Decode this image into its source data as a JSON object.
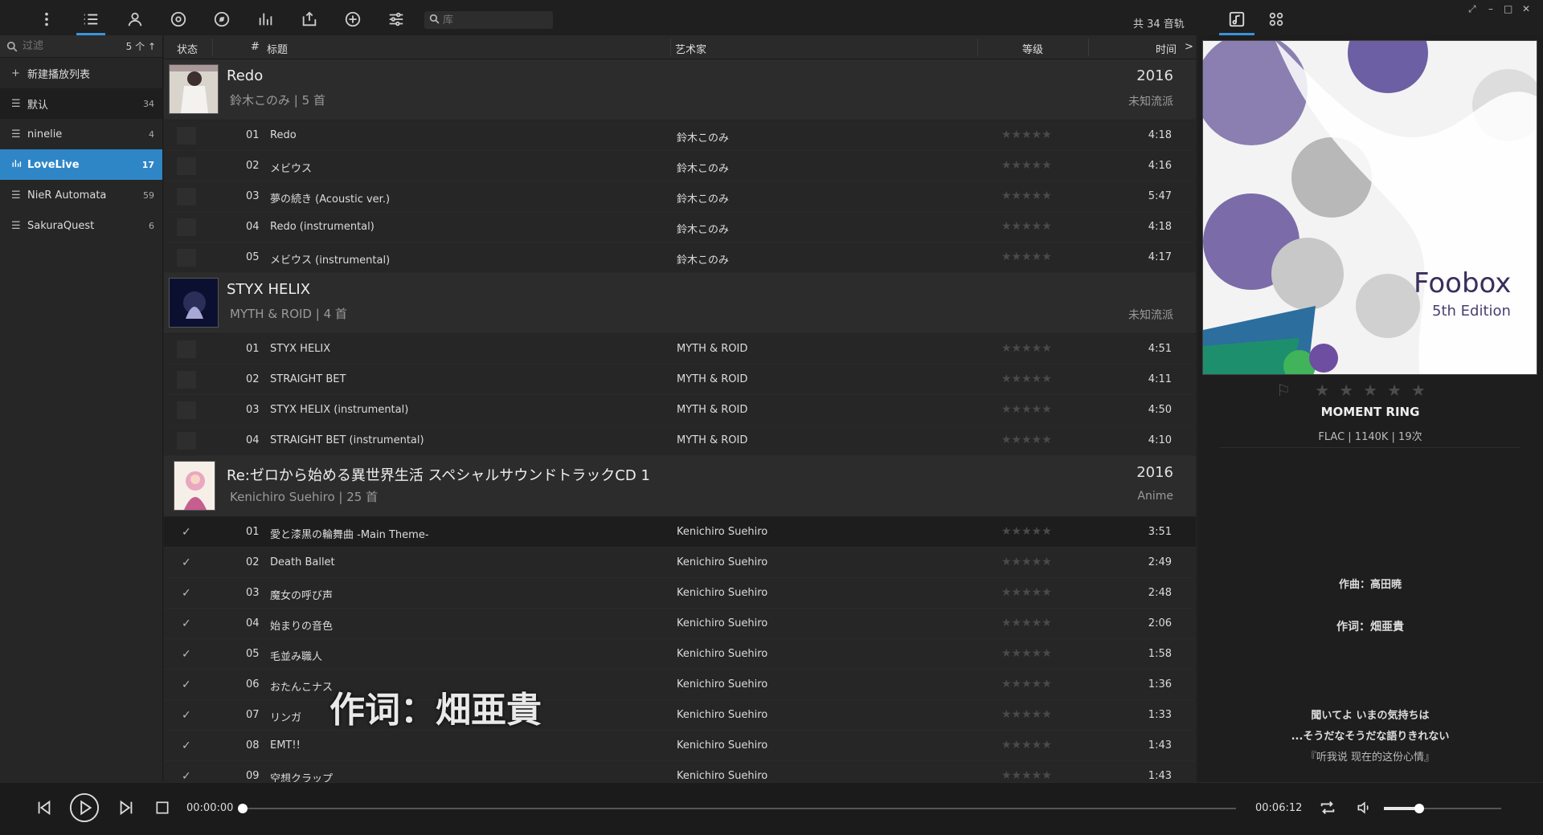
{
  "toolbar": {
    "search_placeholder": "库",
    "track_total": "共 34 音轨"
  },
  "sidebar": {
    "filter_placeholder": "过滤",
    "filter_count": "5 个",
    "new_playlist": "新建播放列表",
    "items": [
      {
        "name": "默认",
        "count": "34"
      },
      {
        "name": "ninelie",
        "count": "4"
      },
      {
        "name": "LoveLive",
        "count": "17"
      },
      {
        "name": "NieR Automata",
        "count": "59"
      },
      {
        "name": "SakuraQuest",
        "count": "6"
      }
    ]
  },
  "columns": {
    "status": "状态",
    "num": "#",
    "title": "标题",
    "artist": "艺术家",
    "rating": "等级",
    "time": "时间",
    "more": ">"
  },
  "groups": [
    {
      "title": "Redo",
      "subtitle": "鈴木このみ | 5 首",
      "year": "2016",
      "genre": "未知流派",
      "tracks": [
        {
          "num": "01",
          "title": "Redo",
          "artist": "鈴木このみ",
          "time": "4:18"
        },
        {
          "num": "02",
          "title": "メビウス",
          "artist": "鈴木このみ",
          "time": "4:16"
        },
        {
          "num": "03",
          "title": "夢の続き (Acoustic ver.)",
          "artist": "鈴木このみ",
          "time": "5:47"
        },
        {
          "num": "04",
          "title": "Redo (instrumental)",
          "artist": "鈴木このみ",
          "time": "4:18"
        },
        {
          "num": "05",
          "title": "メビウス (instrumental)",
          "artist": "鈴木このみ",
          "time": "4:17"
        }
      ]
    },
    {
      "title": "STYX HELIX",
      "subtitle": "MYTH & ROID | 4 首",
      "year": "",
      "genre": "未知流派",
      "tracks": [
        {
          "num": "01",
          "title": "STYX HELIX",
          "artist": "MYTH & ROID",
          "time": "4:51"
        },
        {
          "num": "02",
          "title": "STRAIGHT BET",
          "artist": "MYTH & ROID",
          "time": "4:11"
        },
        {
          "num": "03",
          "title": "STYX HELIX (instrumental)",
          "artist": "MYTH & ROID",
          "time": "4:50"
        },
        {
          "num": "04",
          "title": "STRAIGHT BET (instrumental)",
          "artist": "MYTH & ROID",
          "time": "4:10"
        }
      ]
    },
    {
      "title": "Re:ゼロから始める異世界生活 スペシャルサウンドトラックCD 1",
      "subtitle": "Kenichiro Suehiro | 25 首",
      "year": "2016",
      "genre": "Anime",
      "tracks": [
        {
          "num": "01",
          "title": "愛と漆黒の輪舞曲 -Main Theme-",
          "artist": "Kenichiro Suehiro",
          "time": "3:51"
        },
        {
          "num": "02",
          "title": "Death Ballet",
          "artist": "Kenichiro Suehiro",
          "time": "2:49"
        },
        {
          "num": "03",
          "title": "魔女の呼び声",
          "artist": "Kenichiro Suehiro",
          "time": "2:48"
        },
        {
          "num": "04",
          "title": "始まりの音色",
          "artist": "Kenichiro Suehiro",
          "time": "2:06"
        },
        {
          "num": "05",
          "title": "毛並み職人",
          "artist": "Kenichiro Suehiro",
          "time": "1:58"
        },
        {
          "num": "06",
          "title": "おたんこナス",
          "artist": "Kenichiro Suehiro",
          "time": "1:36"
        },
        {
          "num": "07",
          "title": "リンガ",
          "artist": "Kenichiro Suehiro",
          "time": "1:33"
        },
        {
          "num": "08",
          "title": "EMT!!",
          "artist": "Kenichiro Suehiro",
          "time": "1:43"
        },
        {
          "num": "09",
          "title": "空想クラップ",
          "artist": "Kenichiro Suehiro",
          "time": "1:43"
        }
      ]
    }
  ],
  "overlay_lyric": "作词：畑亜貴",
  "now_playing": {
    "art_title": "Foobox",
    "art_subtitle": "5th Edition",
    "song": "MOMENT RING",
    "meta": "FLAC | 1140K | 19次",
    "lyrics": [
      "作曲：高田暁",
      "作词：畑亜貴",
      "聞いてよ いまの気持ちは",
      "...そうだなそうだな語りきれない",
      "『听我说 现在的这份心情』"
    ]
  },
  "player": {
    "current_time": "00:00:00",
    "total_time": "00:06:12",
    "progress_fraction": 0.0,
    "volume_fraction": 0.3
  },
  "colors": {
    "accent": "#2f86c7",
    "background": "#232323"
  }
}
